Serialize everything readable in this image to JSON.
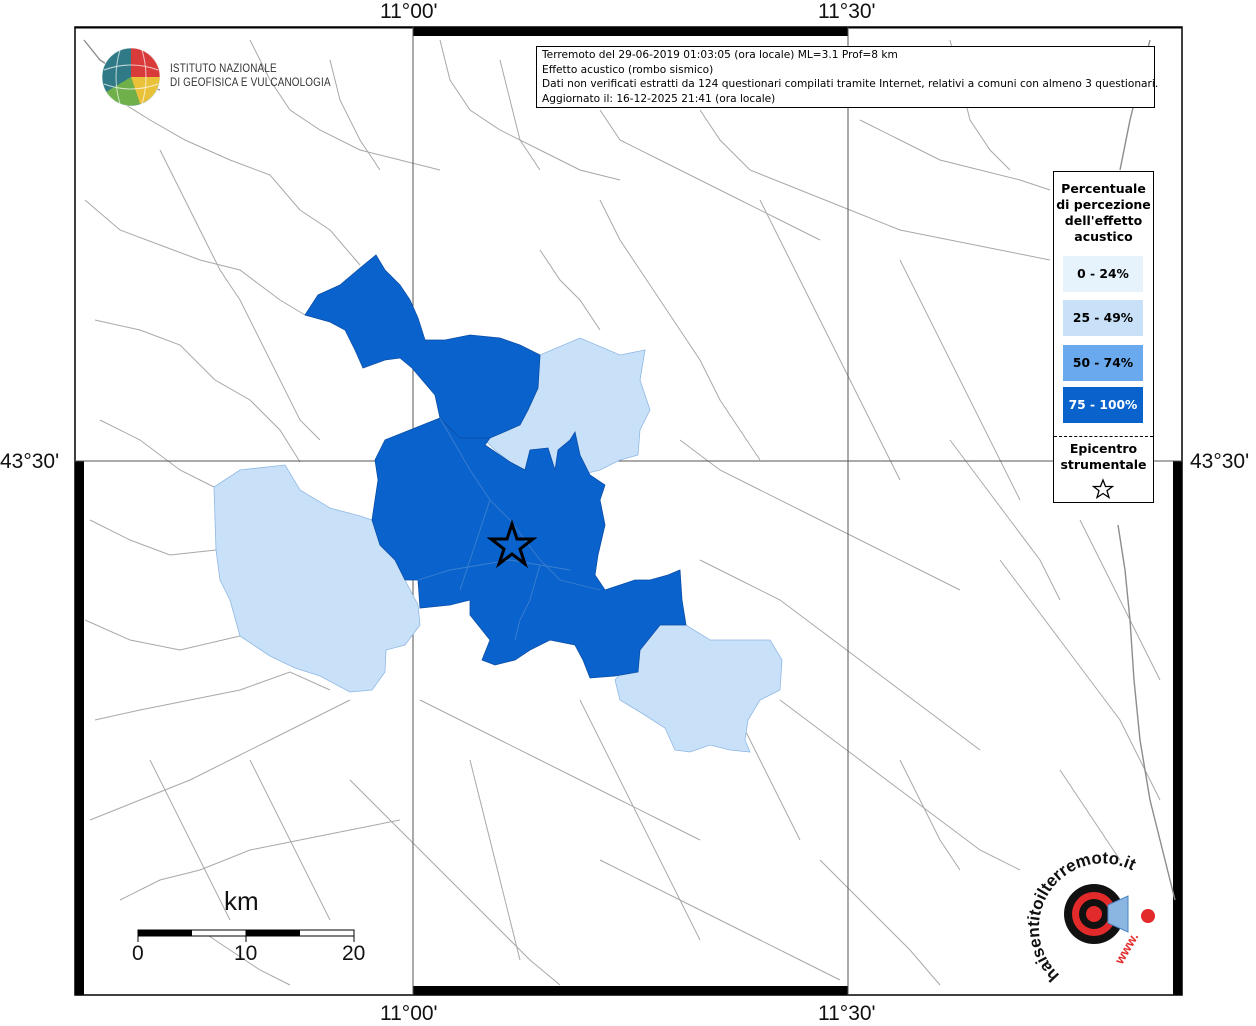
{
  "coords": {
    "top_left": "11°00'",
    "top_right": "11°30'",
    "bottom_left": "11°00'",
    "bottom_right": "11°30'",
    "left_mid": "43°30'",
    "right_mid": "43°30'"
  },
  "info": {
    "line1": "Terremoto del 29-06-2019 01:03:05 (ora locale) ML=3.1 Prof=8 km",
    "line2": "Effetto acustico (rombo sismico)",
    "line3": "Dati non verificati estratti da 124 questionari compilati tramite Internet, relativi a comuni con almeno 3 questionari.",
    "line4": "Aggiornato il: 16-12-2025 21:41 (ora locale)"
  },
  "institute": {
    "line1": "ISTITUTO NAZIONALE",
    "line2": "DI GEOFISICA E VULCANOLOGIA"
  },
  "legend": {
    "title": [
      "Percentuale",
      "di percezione",
      "dell'effetto",
      "acustico"
    ],
    "classes": [
      {
        "label": "0 - 24%",
        "color": "#e6f2fc",
        "text_color": "#000"
      },
      {
        "label": "25 - 49%",
        "color": "#c9e1f8",
        "text_color": "#000"
      },
      {
        "label": "50 - 74%",
        "color": "#6aa9ee",
        "text_color": "#000"
      },
      {
        "label": "75 - 100%",
        "color": "#0a62cc",
        "text_color": "#ffffff"
      }
    ],
    "epicenter": [
      "Epicentro",
      "strumentale"
    ]
  },
  "scale": {
    "unit": "km",
    "labels": [
      "0",
      "10",
      "20"
    ]
  },
  "haisentito": {
    "text": "haisentitoilterremoto.it",
    "url": "www."
  },
  "colors": {
    "class_75_100": "#0a62cc",
    "class_25_49": "#c9e1f8",
    "boundary": "#a8a8a8",
    "grid": "#555555"
  }
}
